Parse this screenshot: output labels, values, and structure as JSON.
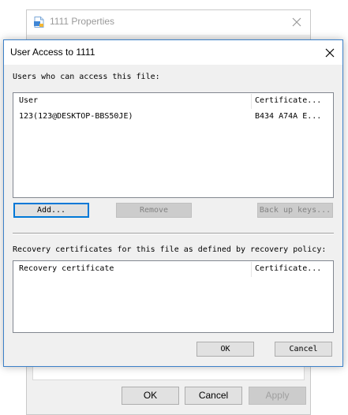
{
  "background_window": {
    "title": "1111 Properties",
    "icon": "document-icon",
    "buttons": {
      "ok": "OK",
      "cancel": "Cancel",
      "apply": "Apply"
    }
  },
  "dialog": {
    "title": "User Access to 1111",
    "close_icon": "close-icon",
    "users_label": "Users who can access this file:",
    "users_table": {
      "columns": [
        "User",
        "Certificate..."
      ],
      "rows": [
        {
          "user": "123(123@DESKTOP-BBS50JE)",
          "certificate": "B434 A74A E..."
        }
      ]
    },
    "buttons": {
      "add": "Add...",
      "remove": "Remove",
      "backup": "Back up keys..."
    },
    "recovery_label": "Recovery certificates for this file as defined by recovery policy:",
    "recovery_table": {
      "columns": [
        "Recovery certificate",
        "Certificate..."
      ],
      "rows": []
    },
    "footer": {
      "ok": "OK",
      "cancel": "Cancel"
    }
  },
  "colors": {
    "dialog_border": "#3c80c8",
    "focus_blue": "#0078d7",
    "face": "#f0f0f0",
    "button_face": "#e1e1e1"
  }
}
